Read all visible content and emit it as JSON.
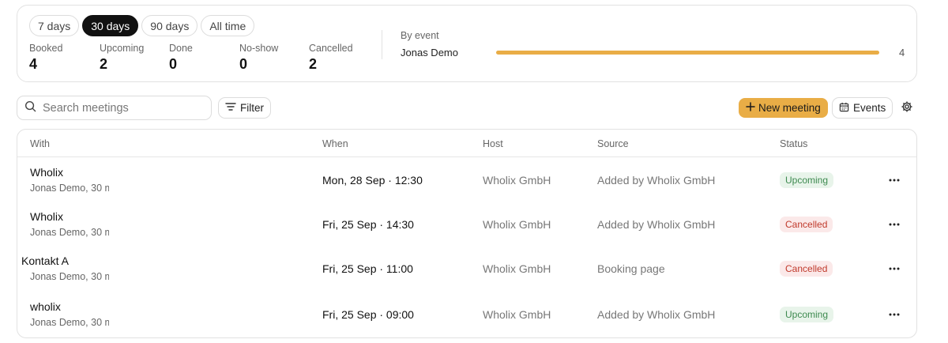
{
  "period_tabs": [
    {
      "label": "7 days",
      "active": false
    },
    {
      "label": "30 days",
      "active": true
    },
    {
      "label": "90 days",
      "active": false
    },
    {
      "label": "All time",
      "active": false
    }
  ],
  "stats": [
    {
      "label": "Booked",
      "value": "4"
    },
    {
      "label": "Upcoming",
      "value": "2"
    },
    {
      "label": "Done",
      "value": "0"
    },
    {
      "label": "No-show",
      "value": "0"
    },
    {
      "label": "Cancelled",
      "value": "2"
    }
  ],
  "by_event": {
    "label": "By event",
    "events": [
      {
        "name": "Jonas Demo",
        "count": "4",
        "fraction": 1.0,
        "color": "#e9ad46"
      }
    ]
  },
  "toolbar": {
    "search_placeholder": "Search meetings",
    "filter_label": "Filter",
    "new_meeting_label": "New meeting",
    "events_label": "Events",
    "icons": [
      "search-icon",
      "filter-icon",
      "plus-icon",
      "calendar-icon",
      "gear-icon"
    ]
  },
  "table": {
    "headers": [
      "With",
      "When",
      "Host",
      "Source",
      "Status"
    ],
    "rows": [
      {
        "name": "Wholix",
        "sub": "Jonas Demo, 30 m",
        "when": "Mon, 28 Sep · 12:30",
        "host": "Wholix GmbH",
        "source": "Added by Wholix GmbH",
        "status": "Upcoming",
        "status_type": "upcoming"
      },
      {
        "name": "Wholix",
        "sub": "Jonas Demo, 30 m",
        "when": "Fri, 25 Sep · 14:30",
        "host": "Wholix GmbH",
        "source": "Added by Wholix GmbH",
        "status": "Cancelled",
        "status_type": "cancelled"
      },
      {
        "name": "Kontakt A",
        "sub": "Jonas Demo, 30 m",
        "when": "Fri, 25 Sep · 11:00",
        "host": "Wholix GmbH",
        "source": "Booking page",
        "status": "Cancelled",
        "status_type": "cancelled"
      },
      {
        "name": "wholix",
        "sub": "Jonas Demo, 30 m",
        "when": "Fri, 25 Sep · 09:00",
        "host": "Wholix GmbH",
        "source": "Added by Wholix GmbH",
        "status": "Upcoming",
        "status_type": "upcoming"
      }
    ]
  },
  "colors": {
    "accent": "#e9ad46",
    "upcoming_bg": "#e8f4ea",
    "upcoming_text": "#3d8a4f",
    "cancelled_bg": "#fbe9e9",
    "cancelled_text": "#c0392b"
  }
}
